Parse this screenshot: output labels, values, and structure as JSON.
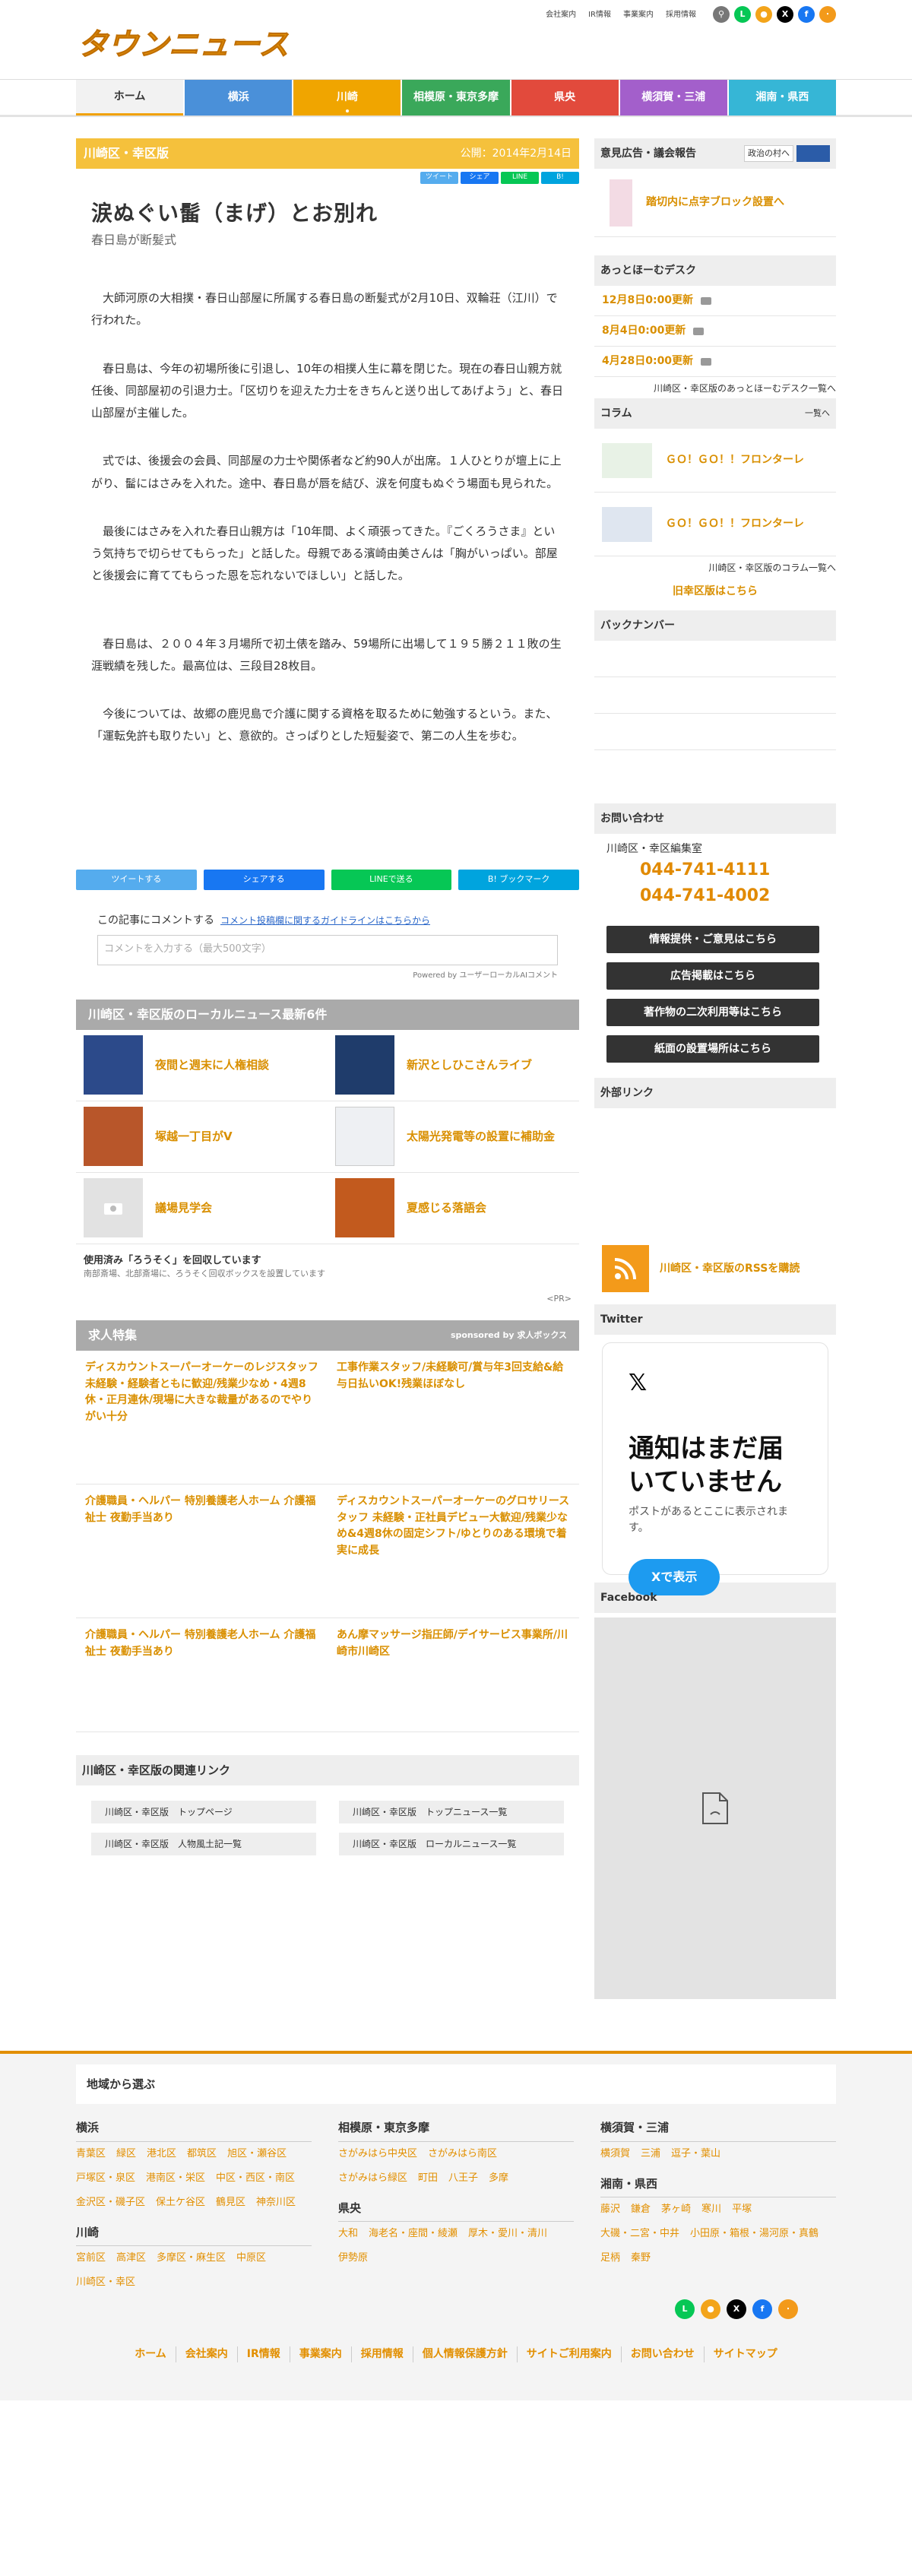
{
  "brand": {
    "logo_text": "タウンニュース",
    "accent": "#e3920a"
  },
  "header": {
    "links": [
      "会社案内",
      "IR情報",
      "事業案内",
      "採用情報"
    ]
  },
  "nav": [
    {
      "label": "ホーム",
      "color": "#f2f2f2"
    },
    {
      "label": "横浜",
      "color": "#4a90d9"
    },
    {
      "label": "川崎",
      "color": "#f0a500"
    },
    {
      "label": "相模原・東京多摩",
      "color": "#3aa85a"
    },
    {
      "label": "県央",
      "color": "#e24a3c"
    },
    {
      "label": "横須賀・三浦",
      "color": "#a35fcb"
    },
    {
      "label": "湘南・県西",
      "color": "#36b6d6"
    }
  ],
  "article": {
    "edition": "川崎区・幸区版",
    "published": "公開：2014年2月14日",
    "share_small": [
      "ツイート",
      "シェア",
      "LINE",
      "B!"
    ],
    "title": "涙ぬぐい髷（まげ）とお別れ",
    "subtitle": "春日島が断髪式",
    "paragraphs": [
      "大師河原の大相撲・春日山部屋に所属する春日島の断髪式が2月10日、双輪荘（江川）で行われた。",
      "春日島は、今年の初場所後に引退し、10年の相撲人生に幕を閉じた。現在の春日山親方就任後、同部屋初の引退力士。「区切りを迎えた力士をきちんと送り出してあげよう」と、春日山部屋が主催した。",
      "式では、後援会の会員、同部屋の力士や関係者など約90人が出席。１人ひとりが壇上に上がり、髷にはさみを入れた。途中、春日島が唇を結び、涙を何度もぬぐう場面も見られた。",
      "最後にはさみを入れた春日山親方は「10年間、よく頑張ってきた。『ごくろうさま』という気持ちで切らせてもらった」と話した。母親である濱崎由美さんは「胸がいっぱい。部屋と後援会に育ててもらった恩を忘れないでほしい」と話した。",
      "春日島は、２００４年３月場所で初土俵を踏み、59場所に出場して１９５勝２１１敗の生涯戦績を残した。最高位は、三段目28枚目。",
      "今後については、故郷の鹿児島で介護に関する資格を取るために勉強するという。また、「運転免許も取りたい」と、意欲的。さっぱりとした短髪姿で、第二の人生を歩む。"
    ],
    "share_bottom": [
      "ツイートする",
      "シェアする",
      "LINEで送る",
      "B! ブックマーク"
    ],
    "comment_label": "この記事にコメントする",
    "comment_link": "コメント投稿欄に関するガイドラインはこちらから",
    "comment_placeholder": "コメントを入力する（最大500文字）",
    "powered": "Powered by ユーザーローカルAIコメント"
  },
  "local_news": {
    "heading": "川崎区・幸区版のローカルニュース最新6件",
    "items": [
      "夜間と週末に人権相談",
      "新沢としひこさんライブ",
      "塚越一丁目がV",
      "太陽光発電等の設置に補助金",
      "議場見学会",
      "夏感じる落語会"
    ],
    "used_title": "使用済み「ろうそく」を回収しています",
    "used_desc": "南部斎場、北部斎場に、ろうそく回収ボックスを設置しています",
    "pr": "<PR>"
  },
  "jobs": {
    "heading": "求人特集",
    "sponsor": "sponsored by 求人ボックス",
    "items": [
      "ディスカウントスーパーオーケーのレジスタッフ 未経験・経験者ともに歓迎/残業少なめ・4週8休・正月連休/現場に大きな裁量があるのでやりがい十分",
      "工事作業スタッフ/未経験可/賞与年3回支給&給与日払いOK!残業ほぼなし",
      "介護職員・ヘルパー 特別養護老人ホーム 介護福祉士 夜勤手当あり",
      "ディスカウントスーパーオーケーのグロサリースタッフ 未経験・正社員デビュー大歓迎/残業少なめ&4週8休の固定シフト/ゆとりのある環境で着実に成長",
      "介護職員・ヘルパー 特別養護老人ホーム 介護福祉士 夜勤手当あり",
      "あん摩マッサージ指圧師/デイサービス事業所/川崎市川崎区"
    ]
  },
  "related": {
    "heading": "川崎区・幸区版の関連リンク",
    "links": [
      "川崎区・幸区版　トップページ",
      "川崎区・幸区版　トップニュース一覧",
      "川崎区・幸区版　人物風土記一覧",
      "川崎区・幸区版　ローカルニュース一覧"
    ]
  },
  "sidebar": {
    "opinion_heading": "意見広告・議会報告",
    "opinion_badge": "政治の村へ",
    "opinion_item": "踏切内に点字ブロック設置へ",
    "aphome_heading": "あっとほーむデスク",
    "aphome_items": [
      "12月8日0:00更新",
      "8月4日0:00更新",
      "4月28日0:00更新"
    ],
    "aphome_more": "川崎区・幸区版のあっとほーむデスク一覧へ",
    "column_heading": "コラム",
    "column_more_short": "一覧へ",
    "column_items": [
      "ＧＯ！ＧＯ！！フロンターレ",
      "ＧＯ！ＧＯ！！フロンターレ"
    ],
    "column_more": "川崎区・幸区版のコラム一覧へ",
    "old_link": "旧幸区版はこちら",
    "backnumber": "バックナンバー",
    "contact_heading": "お問い合わせ",
    "contact_dept": "川崎区・幸区編集室",
    "tels": [
      "044-741-4111",
      "044-741-4002"
    ],
    "buttons": [
      "情報提供・ご意見はこちら",
      "広告掲載はこちら",
      "著作物の二次利用等はこちら",
      "紙面の設置場所はこちら"
    ],
    "external": "外部リンク",
    "rss": "川崎区・幸区版のRSSを購読",
    "twitter_heading": "Twitter",
    "twitter_big": "通知はまだ届いていません",
    "twitter_small": "ポストがあるとここに表示されます。",
    "twitter_btn": "Xで表示",
    "facebook_heading": "Facebook"
  },
  "footer": {
    "region_heading": "地域から選ぶ",
    "col1": [
      {
        "name": "横浜",
        "areas": [
          "青葉区",
          "緑区",
          "港北区",
          "都筑区",
          "旭区・瀬谷区",
          "戸塚区・泉区",
          "港南区・栄区",
          "中区・西区・南区",
          "金沢区・磯子区",
          "保土ケ谷区",
          "鶴見区",
          "神奈川区"
        ]
      },
      {
        "name": "川崎",
        "areas": [
          "宮前区",
          "高津区",
          "多摩区・麻生区",
          "中原区",
          "川崎区・幸区"
        ]
      }
    ],
    "col2": [
      {
        "name": "相模原・東京多摩",
        "areas": [
          "さがみはら中央区",
          "さがみはら南区",
          "さがみはら緑区",
          "町田",
          "八王子",
          "多摩"
        ]
      },
      {
        "name": "県央",
        "areas": [
          "大和",
          "海老名・座間・綾瀬",
          "厚木・愛川・清川",
          "伊勢原"
        ]
      }
    ],
    "col3": [
      {
        "name": "横須賀・三浦",
        "areas": [
          "横須賀",
          "三浦",
          "逗子・葉山"
        ]
      },
      {
        "name": "湘南・県西",
        "areas": [
          "藤沢",
          "鎌倉",
          "茅ヶ崎",
          "寒川",
          "平塚",
          "大磯・二宮・中井",
          "小田原・箱根・湯河原・真鶴",
          "足柄",
          "秦野"
        ]
      }
    ],
    "nav": [
      "ホーム",
      "会社案内",
      "IR情報",
      "事業案内",
      "採用情報",
      "個人情報保護方針",
      "サイトご利用案内",
      "お問い合わせ",
      "サイトマップ"
    ]
  }
}
